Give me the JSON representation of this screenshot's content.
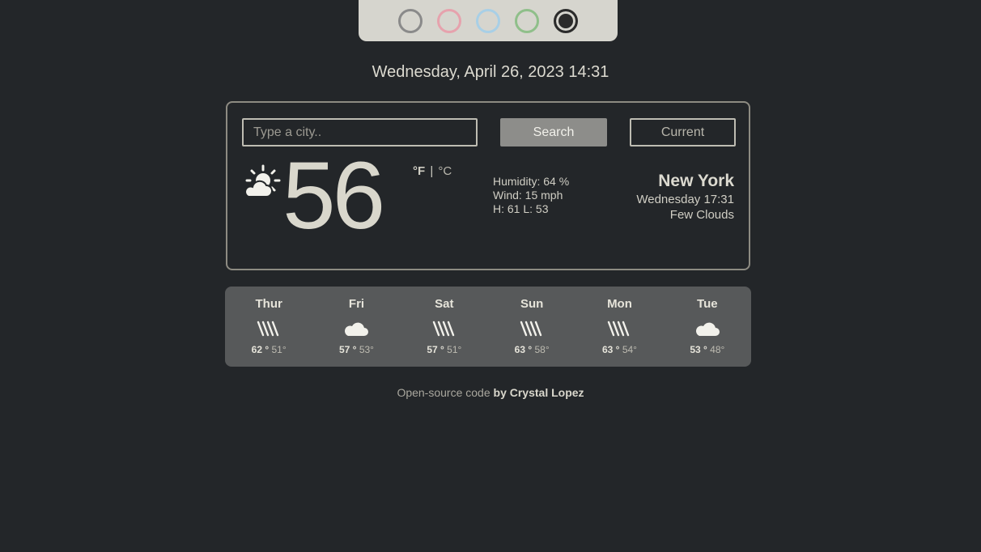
{
  "themes": {
    "colors": [
      "#8a8a8a",
      "#e6a2ad",
      "#a8cfe6",
      "#8fbf8a",
      "#2b2b2b"
    ],
    "active_index": 4
  },
  "date_time": "Wednesday, April 26, 2023 14:31",
  "search": {
    "placeholder": "Type a city..",
    "value": "",
    "search_label": "Search",
    "current_label": "Current"
  },
  "current": {
    "icon": "partly-cloudy-day-icon",
    "temperature": "56",
    "unit_f": "°F",
    "unit_sep": "|",
    "unit_c": "°C",
    "humidity": "Humidity: 64 %",
    "wind": "Wind: 15 mph",
    "high_low": "H: 61 L: 53",
    "city": "New York",
    "local_time": "Wednesday 17:31",
    "description": "Few Clouds"
  },
  "forecast": [
    {
      "day": "Thur",
      "icon": "rain-icon",
      "high": "62 °",
      "low": "51°"
    },
    {
      "day": "Fri",
      "icon": "cloud-icon",
      "high": "57 °",
      "low": "53°"
    },
    {
      "day": "Sat",
      "icon": "rain-icon",
      "high": "57 °",
      "low": "51°"
    },
    {
      "day": "Sun",
      "icon": "rain-icon",
      "high": "63 °",
      "low": "58°"
    },
    {
      "day": "Mon",
      "icon": "rain-icon",
      "high": "63 °",
      "low": "54°"
    },
    {
      "day": "Tue",
      "icon": "cloud-icon",
      "high": "53 °",
      "low": "48°"
    }
  ],
  "footer": {
    "link_text": "Open-source code",
    "author": "by Crystal Lopez"
  }
}
